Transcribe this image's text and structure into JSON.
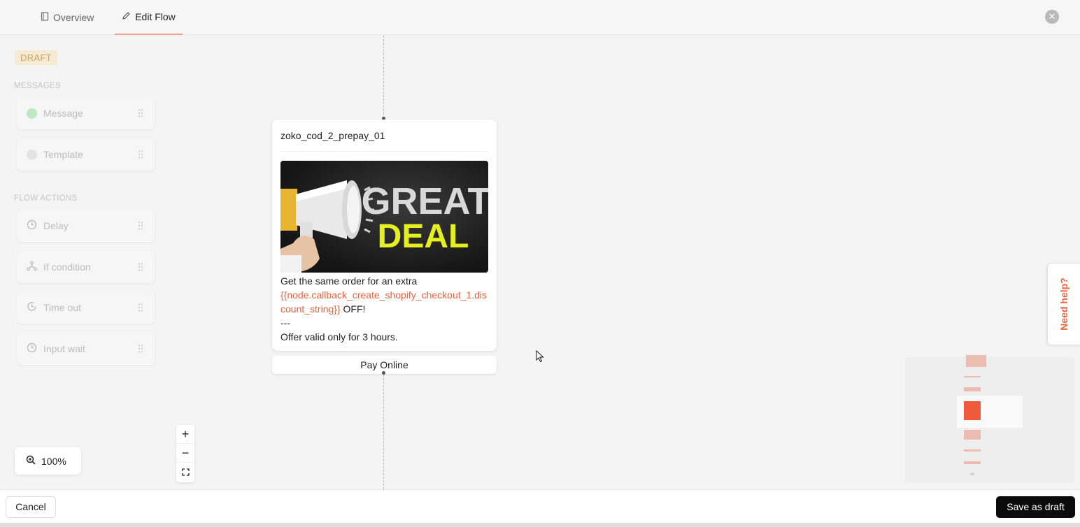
{
  "tabs": [
    {
      "label": "Overview",
      "icon": "book-icon",
      "active": false
    },
    {
      "label": "Edit Flow",
      "icon": "pencil-icon",
      "active": true
    }
  ],
  "status_badge": "DRAFT",
  "palette": {
    "messages_label": "MESSAGES",
    "messages": [
      {
        "label": "Message",
        "icon": "whatsapp-icon"
      },
      {
        "label": "Template",
        "icon": "messenger-icon"
      }
    ],
    "actions_label": "FLOW ACTIONS",
    "actions": [
      {
        "label": "Delay",
        "icon": "clock-icon"
      },
      {
        "label": "If condition",
        "icon": "branch-icon"
      },
      {
        "label": "Time out",
        "icon": "timeout-icon"
      },
      {
        "label": "Input wait",
        "icon": "clock-icon"
      }
    ]
  },
  "node": {
    "title": "zoko_cod_2_prepay_01",
    "image_text_line1": "GREAT",
    "image_text_line2": "DEAL",
    "body_line1": "Get the same order for an extra",
    "body_variable": "{{node.callback_create_shopify_checkout_1.discount_string}}",
    "body_suffix": " OFF!",
    "body_separator": "---",
    "body_line3": "Offer valid only for 3 hours.",
    "button_label": "Pay Online"
  },
  "zoom": {
    "level": "100%"
  },
  "help_label": "Need help?",
  "footer": {
    "cancel_label": "Cancel",
    "save_label": "Save as draft"
  },
  "colors": {
    "accent": "#f0623d",
    "variable": "#e8623e",
    "draft_bg": "#f6ead2",
    "primary_button": "#0b0b0b"
  }
}
